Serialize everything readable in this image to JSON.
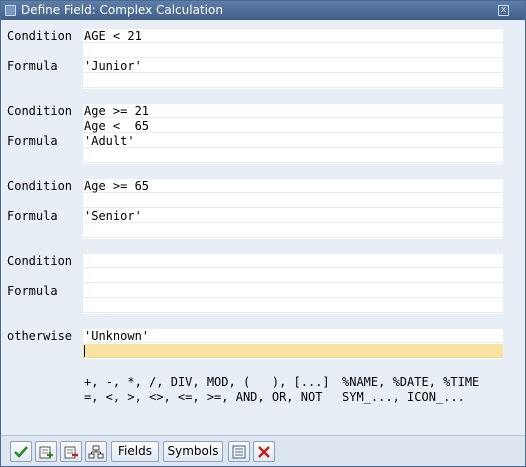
{
  "window": {
    "title": "Define Field: Complex Calculation",
    "close_symbol": "x"
  },
  "blocks": [
    {
      "condition_label": "Condition",
      "formula_label": "Formula",
      "condition_lines": [
        "AGE < 21",
        ""
      ],
      "formula_lines": [
        "'Junior'",
        ""
      ]
    },
    {
      "condition_label": "Condition",
      "formula_label": "Formula",
      "condition_lines": [
        "Age >= 21",
        "Age <  65"
      ],
      "formula_lines": [
        "'Adult'",
        ""
      ]
    },
    {
      "condition_label": "Condition",
      "formula_label": "Formula",
      "condition_lines": [
        "Age >= 65",
        ""
      ],
      "formula_lines": [
        "'Senior'",
        ""
      ]
    },
    {
      "condition_label": "Condition",
      "formula_label": "Formula",
      "condition_lines": [
        "",
        ""
      ],
      "formula_lines": [
        "",
        ""
      ]
    }
  ],
  "otherwise": {
    "label": "otherwise",
    "lines": [
      "'Unknown'",
      ""
    ]
  },
  "help": {
    "operators_line1": "+, -, *, /, DIV, MOD, (   ), [...]",
    "operators_line2": "=, <, >, <>, <=, >=, AND, OR, NOT",
    "symbols_line1": "%NAME, %DATE, %TIME",
    "symbols_line2": "SYM_..., ICON_..."
  },
  "toolbar": {
    "fields_label": "Fields",
    "symbols_label": "Symbols",
    "icons": [
      "check-icon",
      "insert-line-icon",
      "delete-line-icon",
      "structure-icon",
      "list-icon",
      "cancel-icon"
    ]
  }
}
